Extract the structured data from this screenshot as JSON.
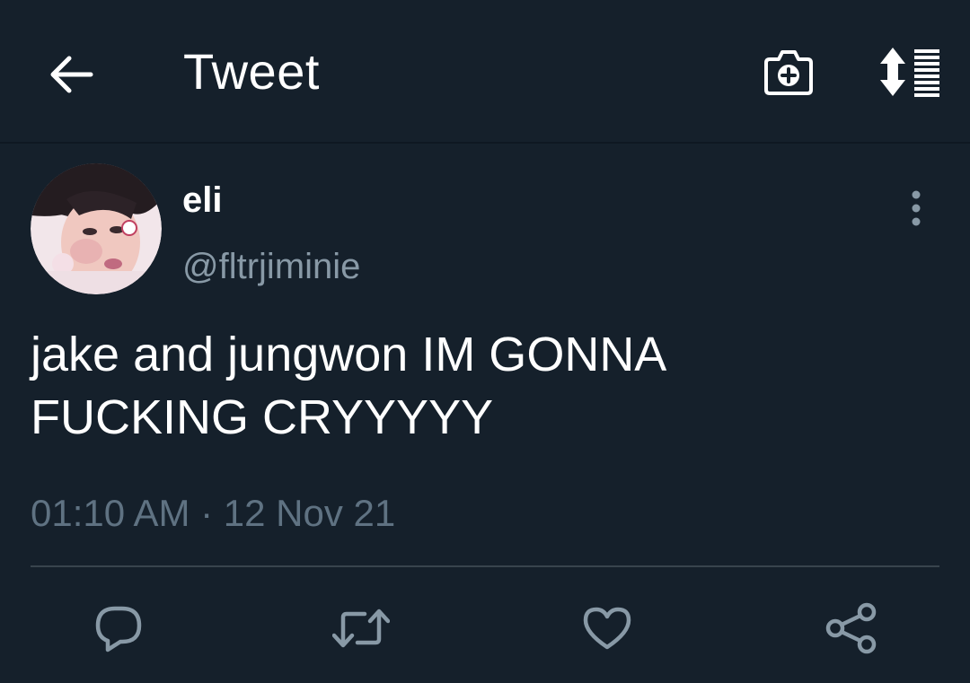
{
  "header": {
    "title": "Tweet",
    "back_icon": "arrow-left-icon",
    "camera_icon": "camera-plus-icon",
    "sort_icon": "sort-icon"
  },
  "tweet": {
    "author": {
      "display_name": "eli",
      "handle": "@fltrjiminie",
      "avatar_icon": "profile-photo"
    },
    "text": "jake and jungwon IM GONNA FUCKING CRYYYYY",
    "timestamp": "01:10 AM · 12 Nov 21",
    "more_icon": "more-vertical-icon"
  },
  "actions": [
    {
      "name": "reply",
      "icon": "reply-icon"
    },
    {
      "name": "retweet",
      "icon": "retweet-icon"
    },
    {
      "name": "like",
      "icon": "heart-icon"
    },
    {
      "name": "share",
      "icon": "share-icon"
    }
  ],
  "colors": {
    "background": "#15202b",
    "primary_text": "#ffffff",
    "secondary_text": "#8899a6",
    "timestamp_text": "#5f7282",
    "icon": "#8899a6",
    "divider": "#38444d"
  }
}
